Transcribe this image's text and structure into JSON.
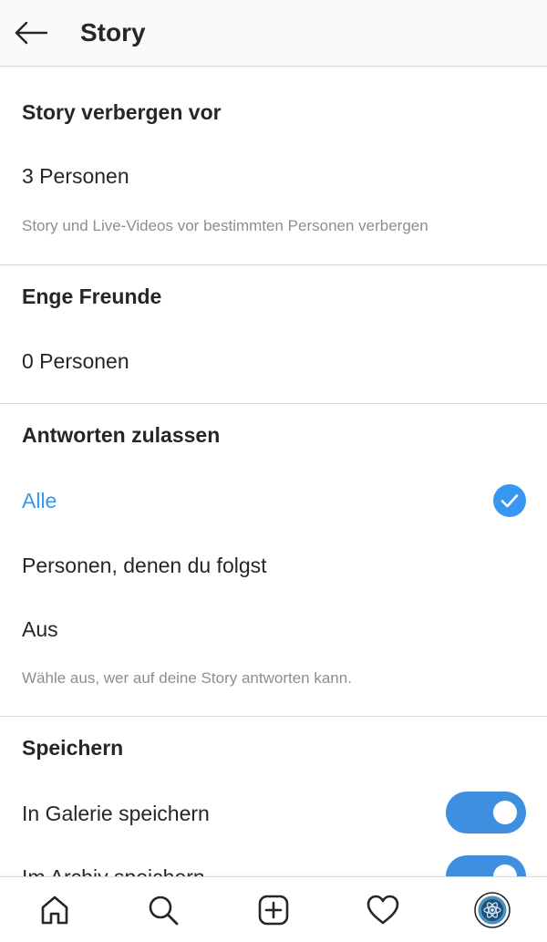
{
  "header": {
    "title": "Story",
    "back_icon": "arrow-left-icon"
  },
  "hide_story": {
    "title": "Story verbergen vor",
    "value": "3 Personen",
    "note": "Story und Live-Videos vor bestimmten Personen verbergen"
  },
  "close_friends": {
    "title": "Enge Freunde",
    "value": "0 Personen"
  },
  "replies": {
    "title": "Antworten zulassen",
    "options": [
      {
        "label": "Alle",
        "selected": true
      },
      {
        "label": "Personen, denen du folgst",
        "selected": false
      },
      {
        "label": "Aus",
        "selected": false
      }
    ],
    "note": "Wähle aus, wer auf deine Story antworten kann."
  },
  "saving": {
    "title": "Speichern",
    "options": [
      {
        "label": "In Galerie speichern",
        "enabled": true
      },
      {
        "label": "Im Archiv speichern",
        "enabled": true
      }
    ]
  },
  "bottom_nav": {
    "items": [
      "home-icon",
      "search-icon",
      "add-post-icon",
      "activity-heart-icon",
      "profile-avatar-icon"
    ]
  },
  "colors": {
    "accent": "#3897f0",
    "toggle_on": "#3f8fe0",
    "text": "#262626",
    "secondary_text": "#8e8e8e",
    "divider": "#dbdbdb"
  }
}
